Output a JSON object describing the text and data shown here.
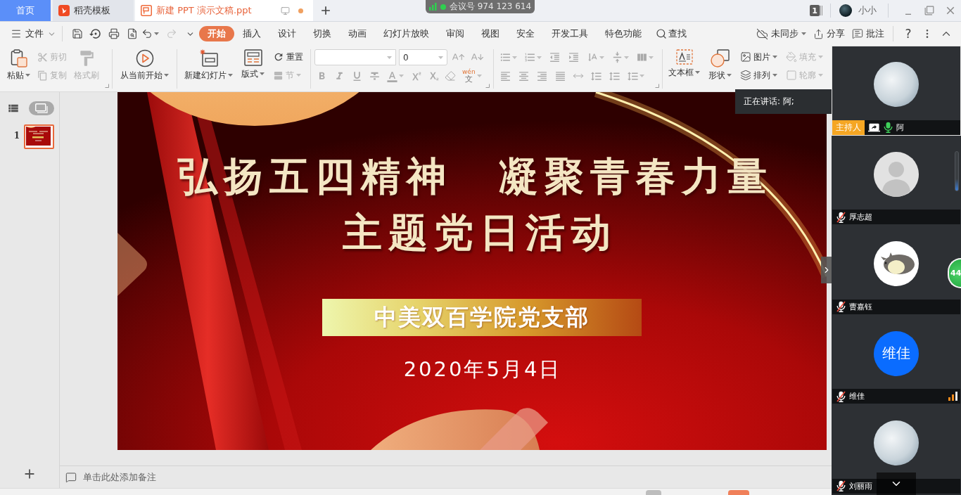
{
  "title_bar": {
    "tabs": [
      {
        "label": "首页",
        "kind": "home",
        "selected": false
      },
      {
        "label": "稻壳模板",
        "kind": "docer",
        "selected": false
      },
      {
        "label": "新建 PPT 演示文稿.ppt",
        "kind": "document",
        "selected": true,
        "modified": true
      }
    ],
    "meeting_number": "会议号 974 123 614",
    "window_count": "1",
    "user_name": "小小"
  },
  "menu": {
    "file": "文件",
    "quick_access": [
      {
        "kind": "save",
        "disabled": false
      },
      {
        "kind": "restore",
        "disabled": false
      },
      {
        "kind": "print",
        "disabled": false
      },
      {
        "kind": "preview",
        "disabled": false
      },
      {
        "kind": "undo",
        "disabled": false
      },
      {
        "kind": "redo",
        "disabled": true
      }
    ],
    "tabs": [
      {
        "label": "开始",
        "selected": true
      },
      {
        "label": "插入",
        "selected": false
      },
      {
        "label": "设计",
        "selected": false
      },
      {
        "label": "切换",
        "selected": false
      },
      {
        "label": "动画",
        "selected": false
      },
      {
        "label": "幻灯片放映",
        "selected": false
      },
      {
        "label": "审阅",
        "selected": false
      },
      {
        "label": "视图",
        "selected": false
      },
      {
        "label": "安全",
        "selected": false
      },
      {
        "label": "开发工具",
        "selected": false
      },
      {
        "label": "特色功能",
        "selected": false
      }
    ],
    "search": "查找",
    "sync": "未同步",
    "share": "分享",
    "comments": "批注",
    "help": "?"
  },
  "ribbon": {
    "paste": {
      "label": "粘贴",
      "disabled": false
    },
    "cut": {
      "label": "剪切",
      "disabled": true
    },
    "copy": {
      "label": "复制",
      "disabled": true
    },
    "format_painter": {
      "label": "格式刷",
      "disabled": true
    },
    "play_from_current": {
      "label": "从当前开始",
      "disabled": false
    },
    "new_slide": {
      "label": "新建幻灯片",
      "disabled": false
    },
    "layout": {
      "label": "版式",
      "disabled": false
    },
    "reset": {
      "label": "重置",
      "disabled": false
    },
    "section": {
      "label": "节",
      "disabled": true
    },
    "font_size": {
      "value": "0"
    },
    "text_format": {
      "disabled": true
    },
    "phonetic": {
      "pinyin": "wén",
      "character": "文"
    },
    "paragraph": {
      "disabled": true
    },
    "text_box": {
      "label": "文本框",
      "disabled": false
    },
    "shape": {
      "label": "形状",
      "disabled": false
    },
    "picture": {
      "label": "图片",
      "disabled": false
    },
    "arrange": {
      "label": "排列",
      "disabled": false
    },
    "fill": {
      "label": "填充",
      "disabled": true
    },
    "outline": {
      "label": "轮廓",
      "disabled": true
    }
  },
  "slide_panel": {
    "views": [
      {
        "kind": "outline",
        "selected": false
      },
      {
        "kind": "thumbnails",
        "selected": true
      }
    ],
    "slides": [
      {
        "number": "1",
        "selected": true
      }
    ]
  },
  "slide": {
    "title": [
      "弘扬五四精神",
      "凝聚青春力量"
    ],
    "subtitle": "主题党日活动",
    "banner": "中美双百学院党支部",
    "date": "2020年5月4日"
  },
  "notes": {
    "placeholder": "单击此处添加备注"
  },
  "meeting": {
    "speaking": "正在讲话: 阿;",
    "floating_badge": "44",
    "participants": [
      {
        "name": "阿",
        "role": "主持人",
        "speaking": true,
        "sharing": true,
        "muted": false,
        "network_warning": false,
        "avatar": {
          "kind": "photo"
        }
      },
      {
        "name": "厚志超",
        "speaking": false,
        "sharing": false,
        "muted": true,
        "network_warning": false,
        "avatar": {
          "kind": "silhouette"
        }
      },
      {
        "name": "曹嘉钰",
        "speaking": false,
        "sharing": false,
        "muted": true,
        "network_warning": false,
        "avatar": {
          "kind": "cartoon"
        }
      },
      {
        "name": "维佳",
        "speaking": false,
        "sharing": false,
        "muted": true,
        "network_warning": true,
        "avatar": {
          "kind": "initials",
          "text": "维佳"
        }
      },
      {
        "name": "刘丽雨",
        "speaking": false,
        "sharing": false,
        "muted": true,
        "network_warning": false,
        "avatar": {
          "kind": "photo"
        }
      }
    ]
  }
}
